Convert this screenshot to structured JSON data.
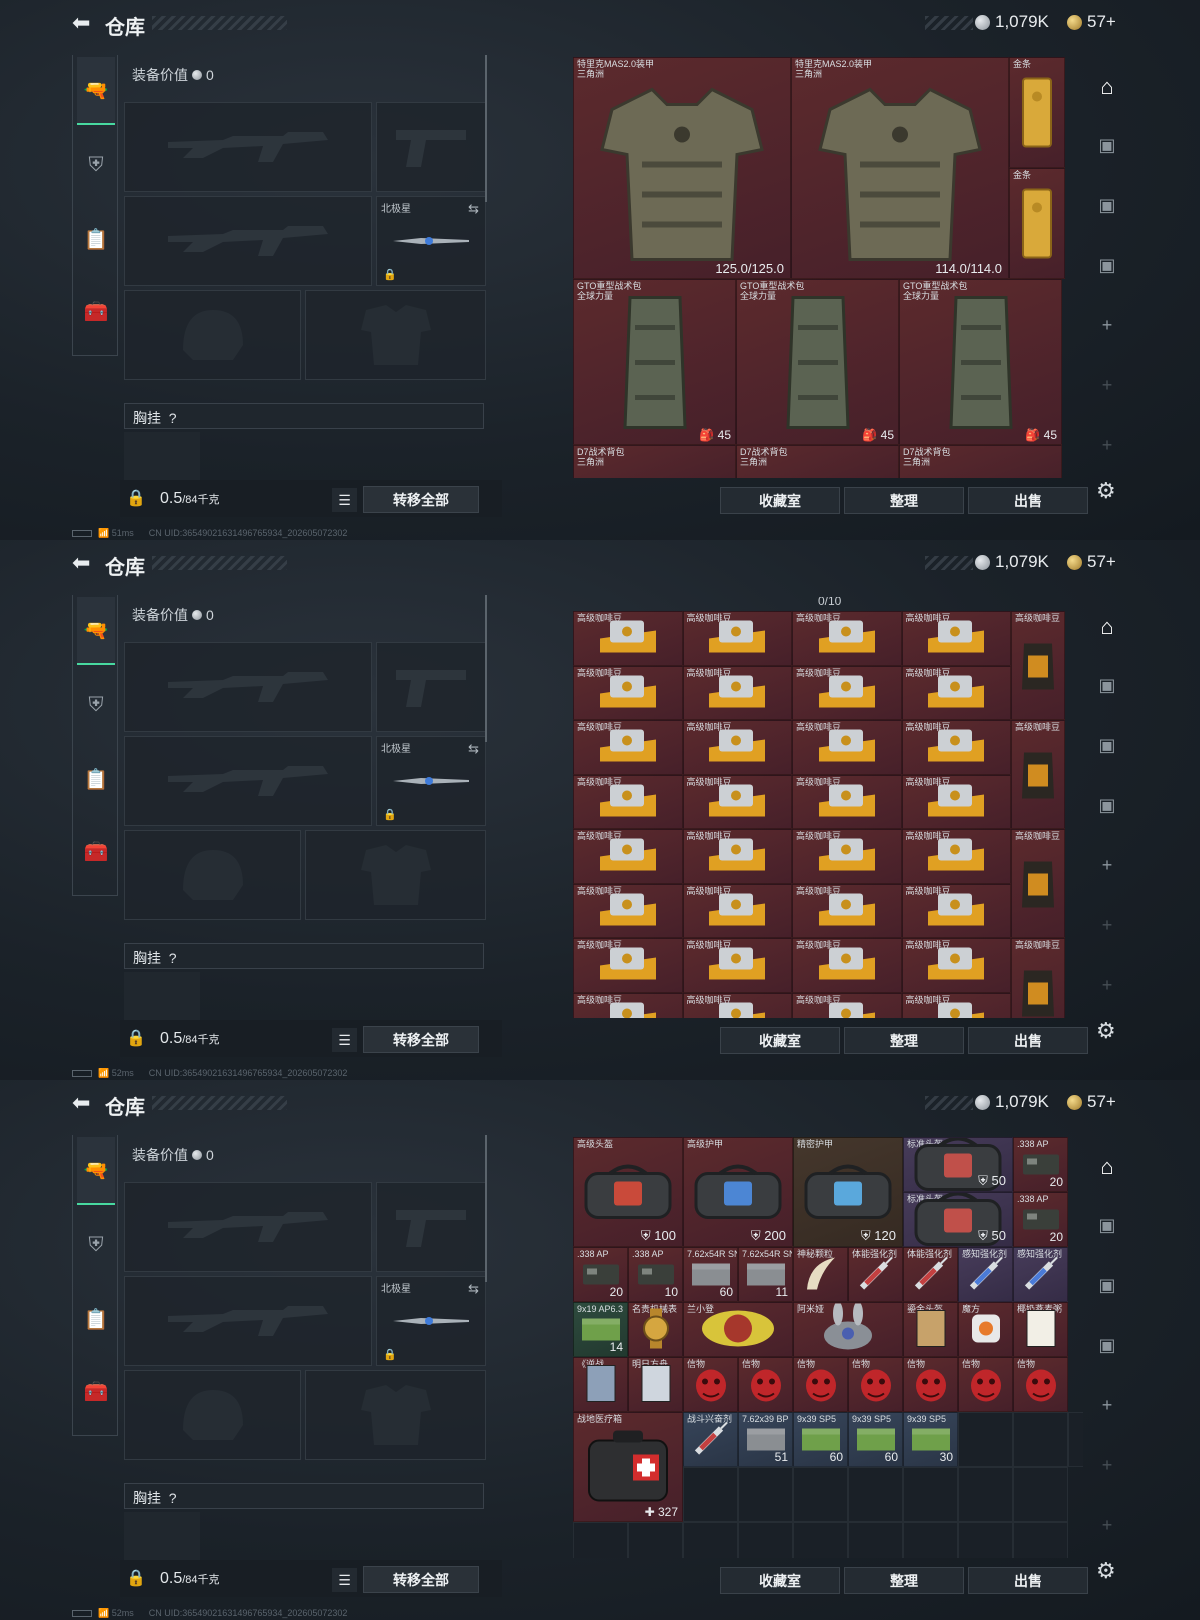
{
  "header": {
    "title": "仓库",
    "silver": "1,079K",
    "gold": "57+",
    "version": "### # ##"
  },
  "nav": {
    "icons": [
      "pistol-icon",
      "armor-icon",
      "clipboard-icon",
      "toolbox-icon"
    ]
  },
  "equipment": {
    "value_label": "装备价值",
    "value": "0",
    "melee_label": "北极星",
    "chest_label": "胸挂",
    "chest_help": "?",
    "weight": "0.5",
    "weight_max": "/84千克",
    "transfer_all": "转移全部"
  },
  "statuses": [
    {
      "ping": "51ms",
      "uid": "CN UID:365490216314967659​34_202605072302"
    },
    {
      "ping": "52ms",
      "uid": "CN UID:36549021631496765934_202605072302"
    },
    {
      "ping": "52ms",
      "uid": "CN UID:36549021631496765934_202605072302"
    }
  ],
  "actions": {
    "collection": "收藏室",
    "sort": "整理",
    "sell": "出售"
  },
  "storage1": {
    "armor1_name": "特里克MAS2.0装甲",
    "armor1_sub": "三角洲",
    "armor1_dur": "125.0/125.0",
    "armor2_name": "特里克MAS2.0装甲",
    "armor2_sub": "三角洲",
    "armor2_dur": "114.0/114.0",
    "gold_name": "金条",
    "bag_name": "GTO重型战术包",
    "bag_sub": "全球力量",
    "bag_count": "45",
    "pack_name": "D7战术背包",
    "pack_sub": "三角洲"
  },
  "storage2": {
    "counter": "0/10",
    "item_name": "高级咖啡豆"
  },
  "storage3": {
    "helmet_bag": "高级头盔",
    "armor_bag": "高级护甲",
    "precise_armor": "精密护甲",
    "std_helmet": "标准头盔",
    "helmet_bag_val": "100",
    "armor_bag_val": "200",
    "precise_val": "120",
    "std_val": "50",
    "ammo_338": ".338 AP",
    "ammo_338_q1": "20",
    "ammo_338_q2": "20",
    "ammo_338_q3": "20",
    "ammo_338_q4": "10",
    "ammo_762x54": "7.62x54R SN",
    "ammo_762x54_q1": "60",
    "ammo_762x54_q2": "11",
    "mystery": "神秘颗粒",
    "stamina": "体能强化剂",
    "perception": "感知强化剂",
    "ammo_919": "9x19 AP6.3",
    "ammo_919_q": "14",
    "watch": "名贵机械表",
    "stool": "兰小登",
    "amiya": "阿米娅",
    "gold_helmet": "鎏金头盔",
    "cube": "魔方",
    "coconut": "椰奶燕麦粥",
    "nizhan": "《逆战",
    "arknights": "明日方舟",
    "token": "信物",
    "medkit": "战地医疗箱",
    "medkit_val": "327",
    "combat_stim": "战斗兴奋剂",
    "ammo_762x39": "7.62x39 BP",
    "ammo_762x39_q": "51",
    "ammo_939": "9x39 SP5",
    "ammo_939_q1": "60",
    "ammo_939_q2": "60",
    "ammo_939_q3": "30"
  }
}
